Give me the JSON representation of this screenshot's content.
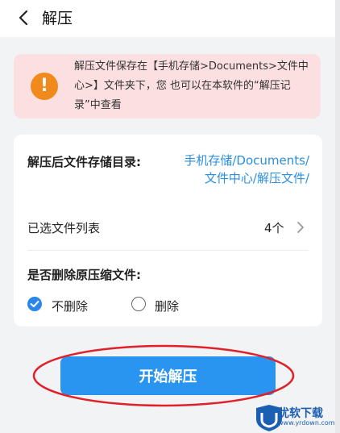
{
  "header": {
    "title": "解压"
  },
  "notice": {
    "text": "解压文件保存在【手机存储>Documents>文件中心>】文件夹下，您 也可以在本软件的“解压记录”中查看"
  },
  "settings": {
    "dir_label": "解压后文件存储目录:",
    "dir_value_line1": "手机存储/Documents/",
    "dir_value_line2": "文件中心/解压文件/",
    "files_label": "已选文件列表",
    "files_count": "4个",
    "delete_label": "是否删除原压缩文件:",
    "options": [
      {
        "label": "不删除",
        "selected": true
      },
      {
        "label": "删除",
        "selected": false
      }
    ]
  },
  "action": {
    "start_label": "开始解压"
  },
  "watermark": {
    "brand": "优软下载",
    "url": "www.yrdown.com"
  },
  "colors": {
    "accent": "#2a95f0",
    "notice_bg": "#fbdfe1",
    "warning": "#f08a1c",
    "link": "#2b8fe0"
  }
}
